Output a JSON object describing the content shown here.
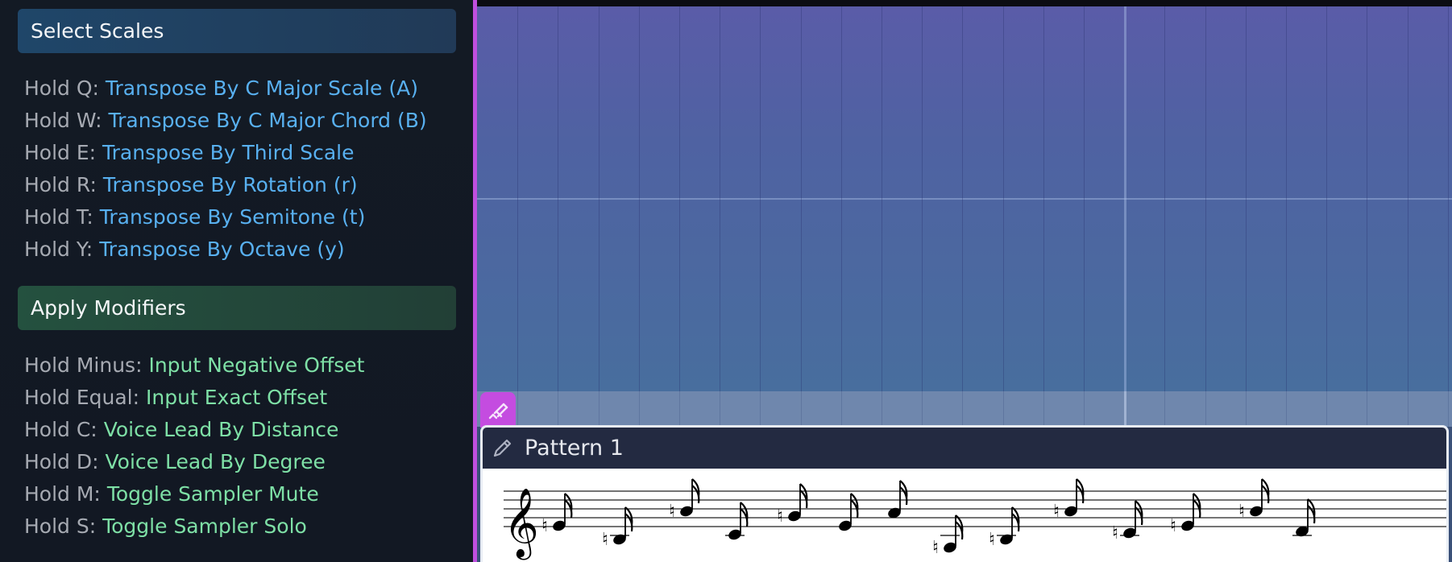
{
  "scales": {
    "title": "Select Scales",
    "items": [
      {
        "key": "Hold Q:",
        "action": "Transpose By C Major Scale (A)"
      },
      {
        "key": "Hold W:",
        "action": "Transpose By C Major Chord (B)"
      },
      {
        "key": "Hold E:",
        "action": "Transpose By Third Scale"
      },
      {
        "key": "Hold R:",
        "action": "Transpose By Rotation (r)"
      },
      {
        "key": "Hold T:",
        "action": "Transpose By Semitone (t)"
      },
      {
        "key": "Hold Y:",
        "action": "Transpose By Octave (y)"
      }
    ]
  },
  "modifiers": {
    "title": "Apply Modifiers",
    "items": [
      {
        "key": "Hold Minus:",
        "action": "Input Negative Offset"
      },
      {
        "key": "Hold Equal:",
        "action": "Input Exact Offset"
      },
      {
        "key": "Hold C:",
        "action": "Voice Lead By Distance"
      },
      {
        "key": "Hold D:",
        "action": "Voice Lead By Degree"
      },
      {
        "key": "Hold M:",
        "action": "Toggle Sampler Mute"
      },
      {
        "key": "Hold S:",
        "action": "Toggle Sampler Solo"
      }
    ]
  },
  "pattern": {
    "title": "Pattern 1",
    "edit_icon": "pencil-icon",
    "brush_icon": "brush-icon"
  },
  "colors": {
    "scale_action": "#58b0f0",
    "modifier_action": "#7ee0a6",
    "accent": "#c04fde"
  }
}
